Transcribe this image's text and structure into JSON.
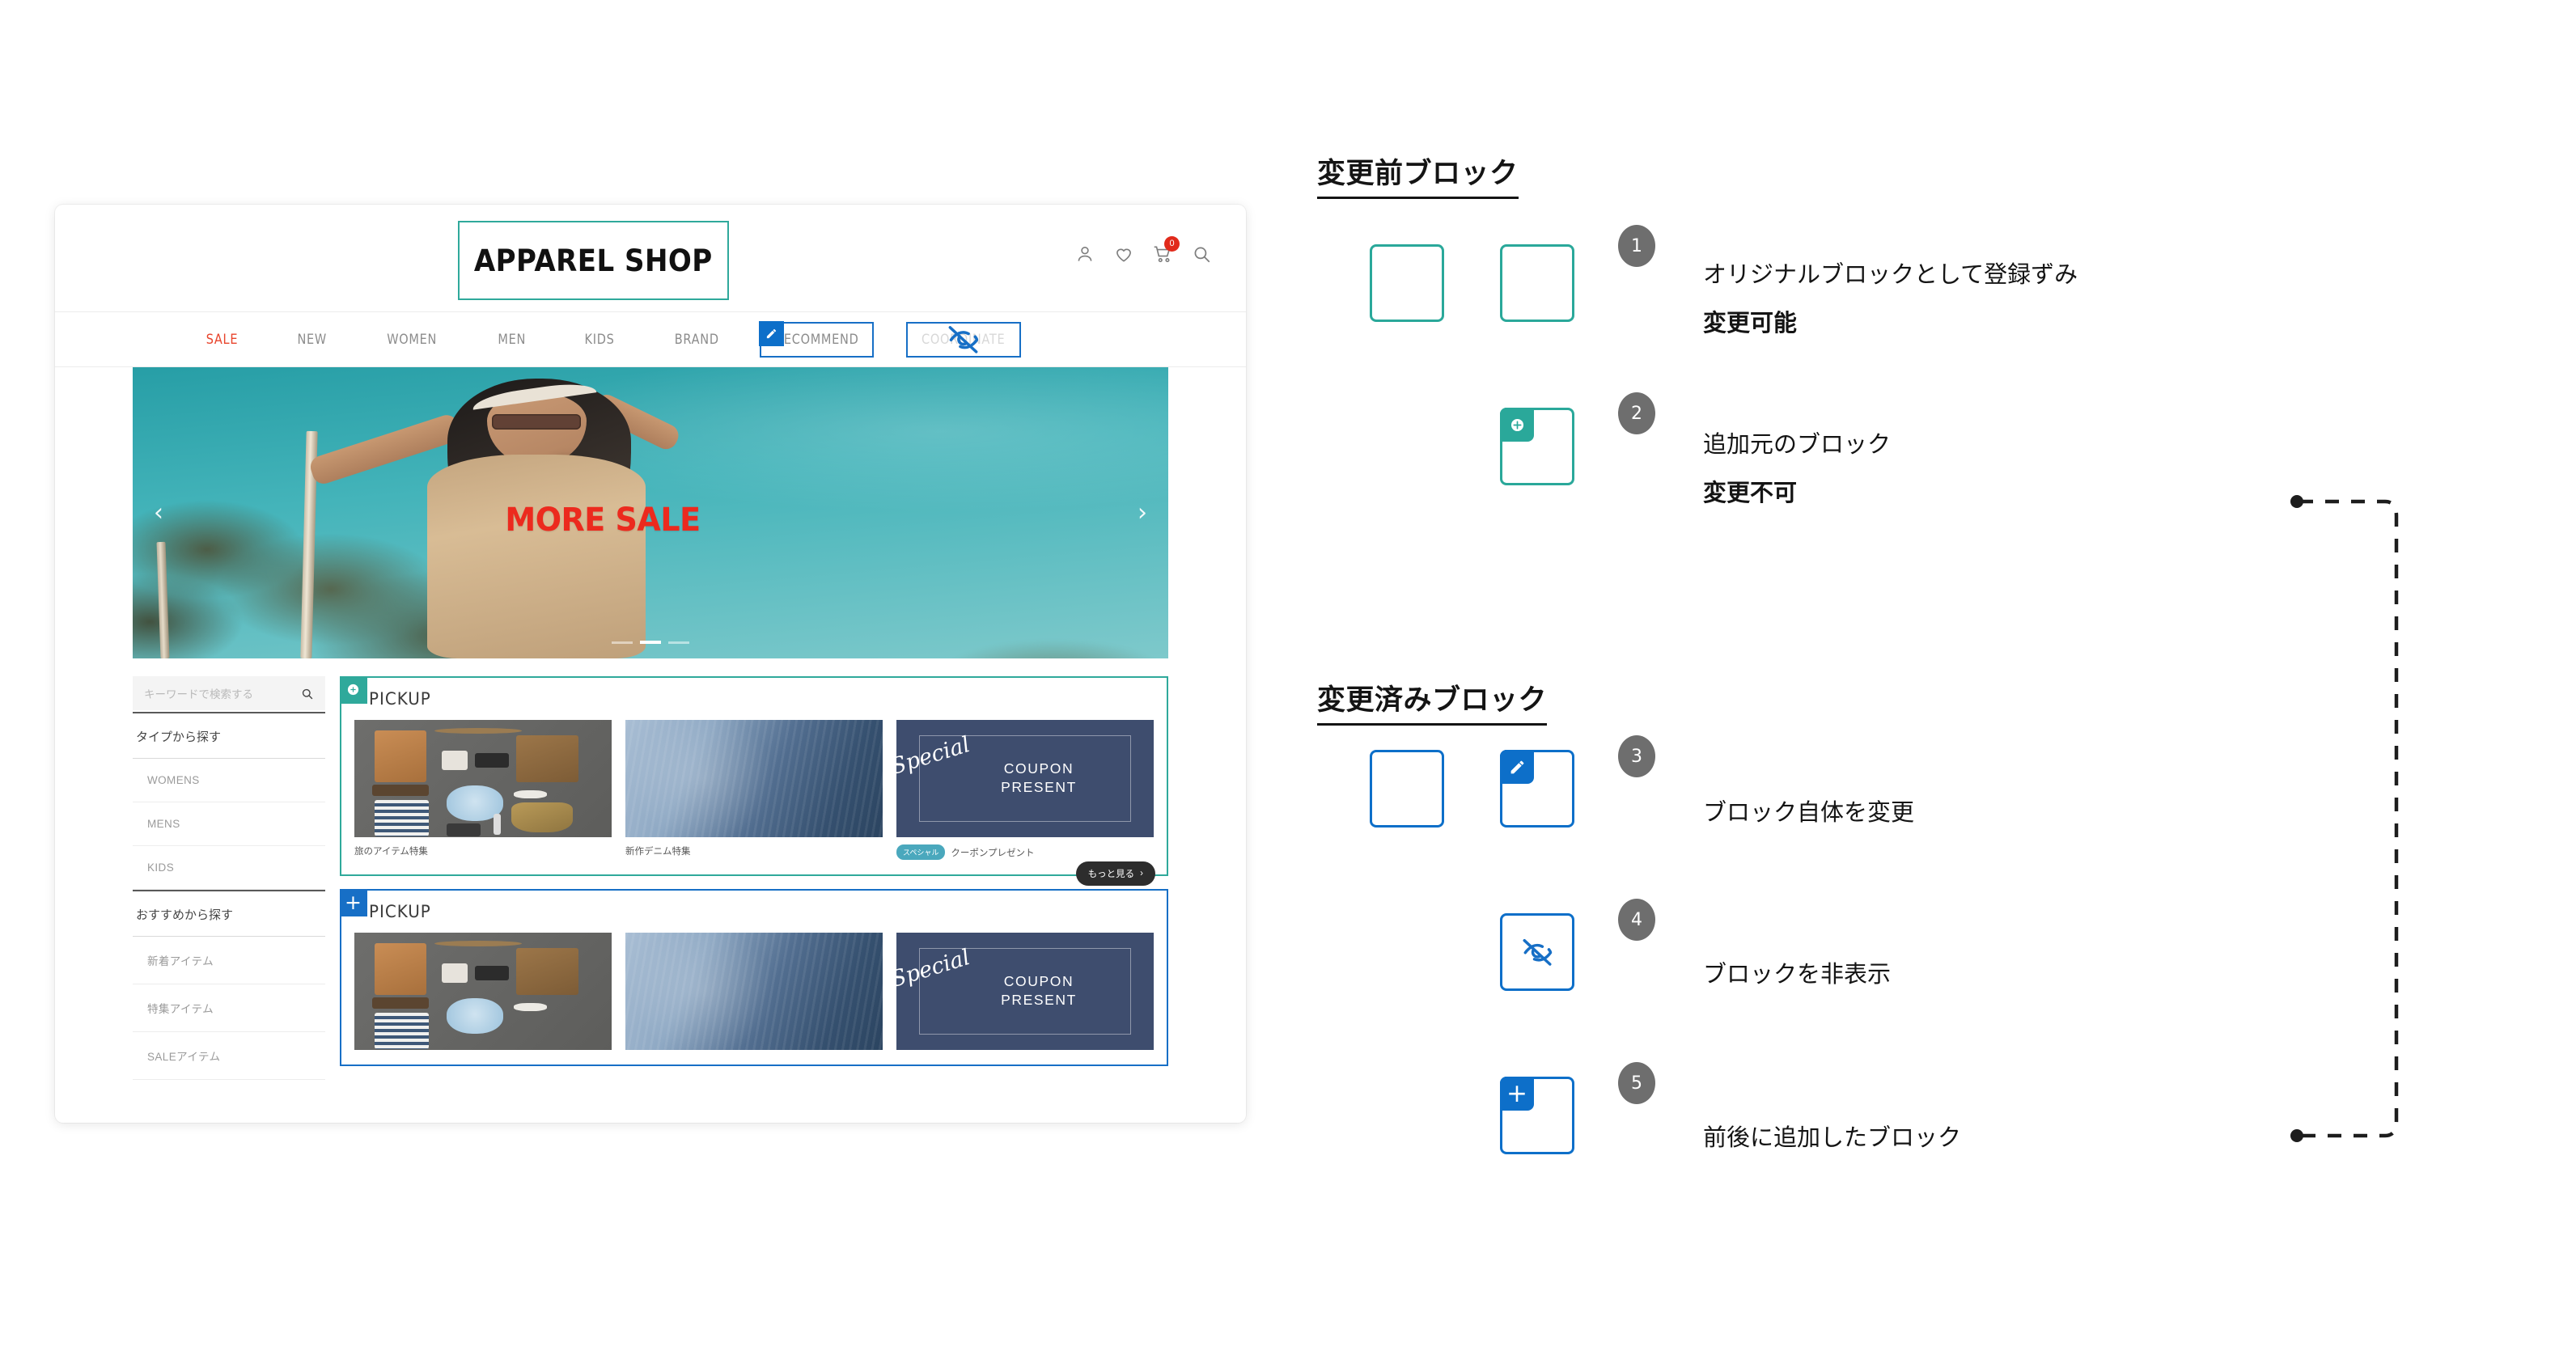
{
  "mockup": {
    "logo": "APPAREL SHOP",
    "header_icons": [
      {
        "name": "account-icon"
      },
      {
        "name": "wishlist-heart-icon"
      },
      {
        "name": "cart-icon",
        "badge": "0"
      },
      {
        "name": "search-icon"
      }
    ],
    "nav": [
      {
        "label": "SALE",
        "state": "sale"
      },
      {
        "label": "NEW",
        "state": "normal"
      },
      {
        "label": "WOMEN",
        "state": "normal"
      },
      {
        "label": "MEN",
        "state": "normal"
      },
      {
        "label": "KIDS",
        "state": "normal"
      },
      {
        "label": "BRAND",
        "state": "normal"
      },
      {
        "label": "RECOMMEND",
        "state": "edited"
      },
      {
        "label": "COORDINATE",
        "state": "hidden"
      }
    ],
    "hero": {
      "title": "MORE SALE",
      "prev_arrow": "‹",
      "next_arrow": "›",
      "slide_count": 3,
      "active_slide": 2
    },
    "sidebar": {
      "search_placeholder": "キーワードで検索する",
      "groups": [
        {
          "heading": "タイプから探す",
          "links": [
            "WOMENS",
            "MENS",
            "KIDS"
          ]
        },
        {
          "heading": "おすすめから探す",
          "links": [
            "新着アイテム",
            "特集アイテム",
            "SALEアイテム"
          ]
        }
      ]
    },
    "pickup_blocks": [
      {
        "title": "PICKUP",
        "accent": "#2fa99b",
        "badge_icon": "plus-circle-icon",
        "more_label": "もっと見る",
        "more_arrow": "›",
        "cards": [
          {
            "caption": "旅のアイテム特集",
            "tag": "",
            "kind": "travel"
          },
          {
            "caption": "新作デニム特集",
            "tag": "",
            "kind": "denim"
          },
          {
            "caption": "クーポンプレゼント",
            "tag": "スペシャル",
            "kind": "coupon",
            "script": "Special",
            "line1": "COUPON",
            "line2": "PRESENT"
          }
        ]
      },
      {
        "title": "PICKUP",
        "accent": "#176fc6",
        "badge_icon": "plus-icon",
        "more_label": "",
        "more_arrow": "",
        "cards": [
          {
            "caption": "",
            "tag": "",
            "kind": "travel"
          },
          {
            "caption": "",
            "tag": "",
            "kind": "denim"
          },
          {
            "caption": "",
            "tag": "",
            "kind": "coupon",
            "script": "Special",
            "line1": "COUPON",
            "line2": "PRESENT"
          }
        ]
      }
    ]
  },
  "diagram": {
    "sections": [
      {
        "title": "変更前ブロック"
      },
      {
        "title": "変更済みブロック"
      }
    ],
    "items": [
      {
        "number": "1",
        "line1": "オリジナルブロックとして登録ずみ",
        "line2": "変更可能",
        "accent": "#2aa89a",
        "badge": "none"
      },
      {
        "number": "2",
        "line1": "追加元のブロック",
        "line2": "変更不可",
        "accent": "#2aa89a",
        "badge": "plus-circle-icon"
      },
      {
        "number": "3",
        "line1": "ブロック自体を変更",
        "line2": "",
        "accent": "#0d6fc9",
        "badge": "pencil-icon"
      },
      {
        "number": "4",
        "line1": "ブロックを非表示",
        "line2": "",
        "accent": "#0d6fc9",
        "badge": "eye-off-icon"
      },
      {
        "number": "5",
        "line1": "前後に追加したブロック",
        "line2": "",
        "accent": "#0d6fc9",
        "badge": "plus-icon"
      }
    ],
    "colors": {
      "teal": "#2aa89a",
      "blue": "#0d6fc9",
      "bubble_gray": "#6e6e6e",
      "text": "#141414"
    }
  }
}
